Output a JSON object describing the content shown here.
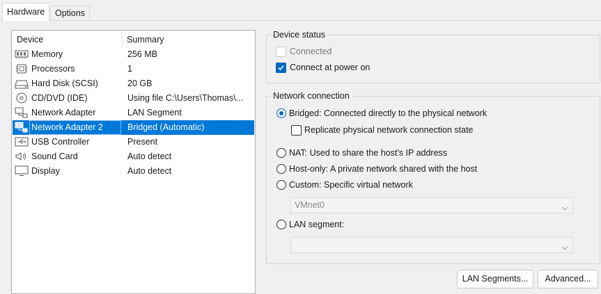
{
  "tabs": [
    {
      "label": "Hardware",
      "active": true
    },
    {
      "label": "Options",
      "active": false
    }
  ],
  "device_list": {
    "columns": [
      "Device",
      "Summary"
    ],
    "items": [
      {
        "icon": "memory-icon",
        "device": "Memory",
        "summary": "256 MB"
      },
      {
        "icon": "processor-icon",
        "device": "Processors",
        "summary": "1"
      },
      {
        "icon": "hard-disk-icon",
        "device": "Hard Disk (SCSI)",
        "summary": "20 GB"
      },
      {
        "icon": "cd-dvd-icon",
        "device": "CD/DVD (IDE)",
        "summary": "Using file C:\\Users\\Thomas\\..."
      },
      {
        "icon": "network-adapter-icon",
        "device": "Network Adapter",
        "summary": "LAN Segment"
      },
      {
        "icon": "network-adapter-icon",
        "device": "Network Adapter 2",
        "summary": "Bridged (Automatic)",
        "selected": true
      },
      {
        "icon": "usb-icon",
        "device": "USB Controller",
        "summary": "Present"
      },
      {
        "icon": "sound-card-icon",
        "device": "Sound Card",
        "summary": "Auto detect"
      },
      {
        "icon": "display-icon",
        "device": "Display",
        "summary": "Auto detect"
      }
    ]
  },
  "device_status": {
    "title": "Device status",
    "connected": {
      "label": "Connected",
      "checked": false,
      "enabled": false
    },
    "connect_at_power_on": {
      "label": "Connect at power on",
      "checked": true,
      "enabled": true
    }
  },
  "network_connection": {
    "title": "Network connection",
    "bridged": {
      "label": "Bridged: Connected directly to the physical network",
      "selected": true
    },
    "replicate": {
      "label": "Replicate physical network connection state",
      "checked": false
    },
    "nat": {
      "label": "NAT: Used to share the host's IP address",
      "selected": false
    },
    "host_only": {
      "label": "Host-only: A private network shared with the host",
      "selected": false
    },
    "custom": {
      "label": "Custom: Specific virtual network",
      "selected": false
    },
    "custom_network_value": "VMnet0",
    "lan_segment": {
      "label": "LAN segment:",
      "selected": false
    },
    "lan_segment_value": ""
  },
  "buttons": {
    "lan_segments": "LAN Segments...",
    "advanced": "Advanced..."
  },
  "colors": {
    "selection": "#0078d7",
    "accent": "#0067c0"
  }
}
